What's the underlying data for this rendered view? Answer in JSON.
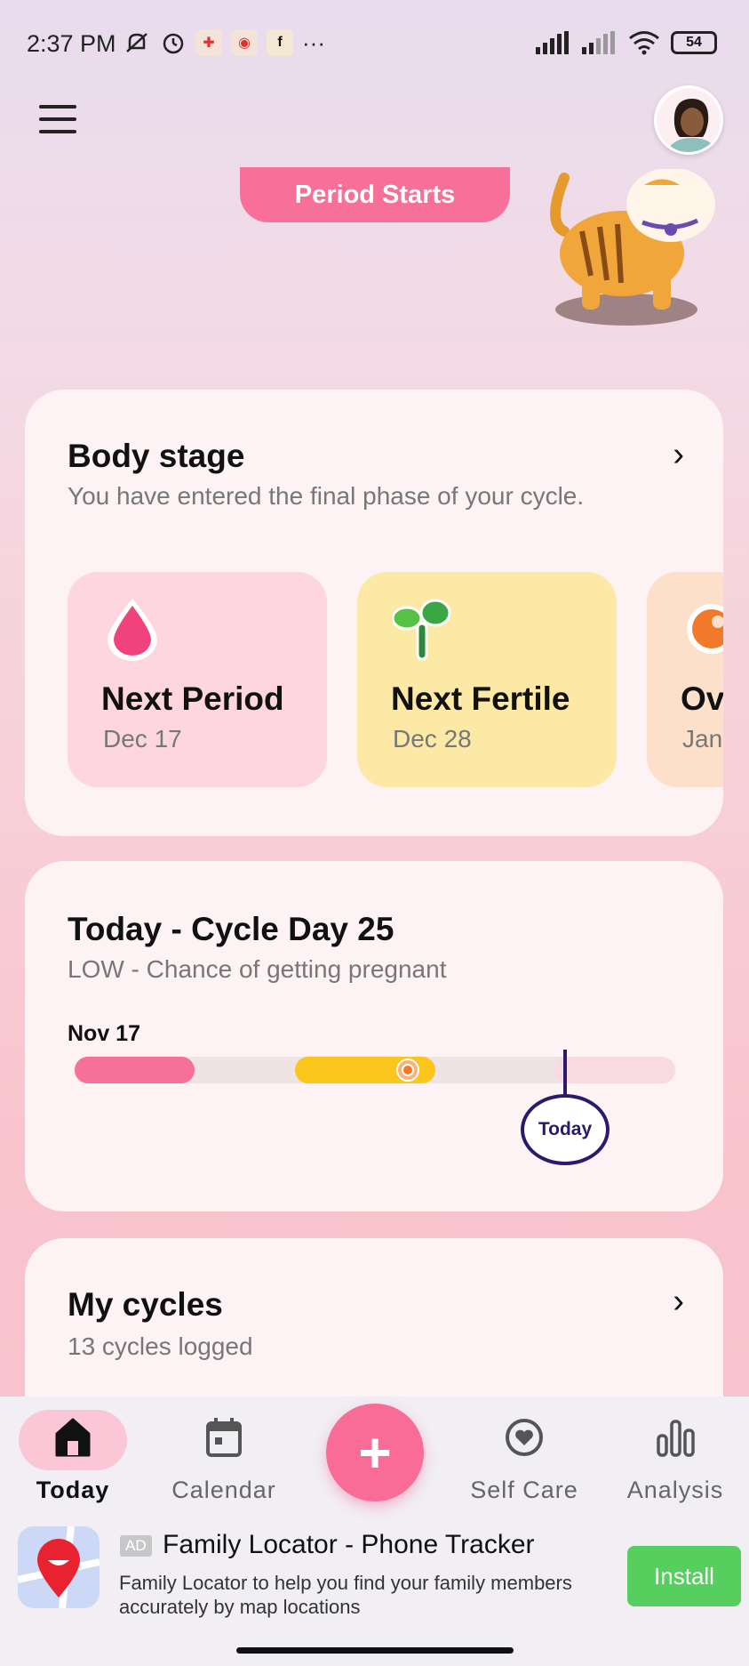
{
  "status_bar": {
    "time": "2:37 PM",
    "battery": "54",
    "more": "···"
  },
  "header": {
    "banner": "Period Starts"
  },
  "body_stage": {
    "title": "Body stage",
    "subtitle": "You have entered the final phase of your cycle.",
    "cards": [
      {
        "title": "Next Period",
        "date": "Dec 17",
        "color": "#fdd6df",
        "icon": "drop-icon"
      },
      {
        "title": "Next Fertile",
        "date": "Dec 28",
        "color": "#fde9a6",
        "icon": "sprout-icon"
      },
      {
        "title": "Ovu",
        "date": "Jan",
        "color": "#fde0c9",
        "icon": "ovulation-icon"
      }
    ]
  },
  "today_card": {
    "title": "Today - Cycle Day 25",
    "subtitle": "LOW - Chance of getting pregnant",
    "start_date": "Nov 17",
    "today_label": "Today",
    "colors": {
      "period": "#f5709b",
      "fertile": "#fcc51c",
      "marker": "#2b1a6b"
    }
  },
  "my_cycles": {
    "title": "My cycles",
    "subtitle": "13 cycles logged"
  },
  "bottom_nav": {
    "items": [
      {
        "label": "Today",
        "icon": "home-icon"
      },
      {
        "label": "Calendar",
        "icon": "calendar-icon"
      },
      {
        "label": "Self Care",
        "icon": "heart-icon"
      },
      {
        "label": "Analysis",
        "icon": "bar-chart-icon"
      }
    ],
    "add_label": "+"
  },
  "ad": {
    "badge": "AD",
    "title": "Family Locator - Phone Tracker",
    "description": "Family Locator to help you find your family members accurately by map locations",
    "install_label": "Install"
  }
}
